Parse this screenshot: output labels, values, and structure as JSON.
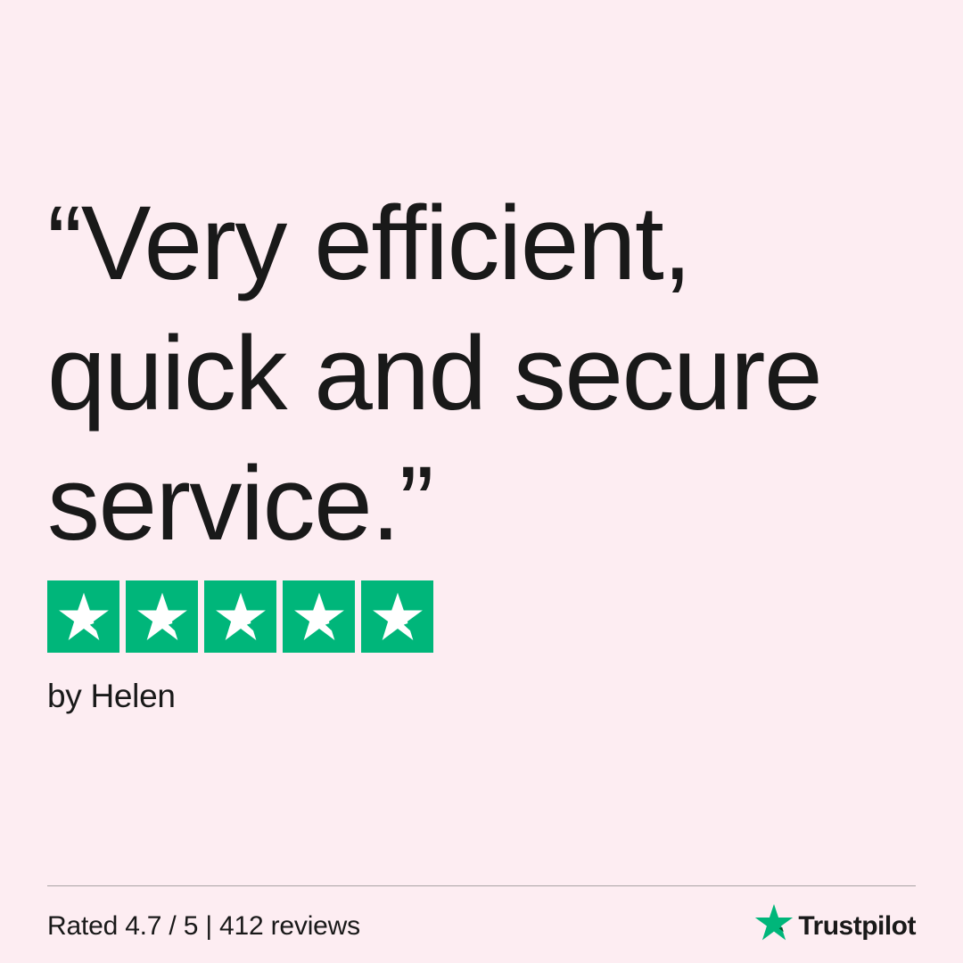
{
  "review": {
    "quote_lines": [
      "“Very efficient,",
      "quick and secure",
      "service.”"
    ],
    "rating_stars": 5,
    "author": "by Helen"
  },
  "footer": {
    "summary": "Rated 4.7 / 5 | 412 reviews",
    "brand_name": "Trustpilot"
  },
  "colors": {
    "background": "#fdedf2",
    "star_green": "#00b67a",
    "text": "#191919"
  },
  "icons": {
    "rating_star": "star-icon",
    "brand_logo": "trustpilot-star-icon"
  }
}
